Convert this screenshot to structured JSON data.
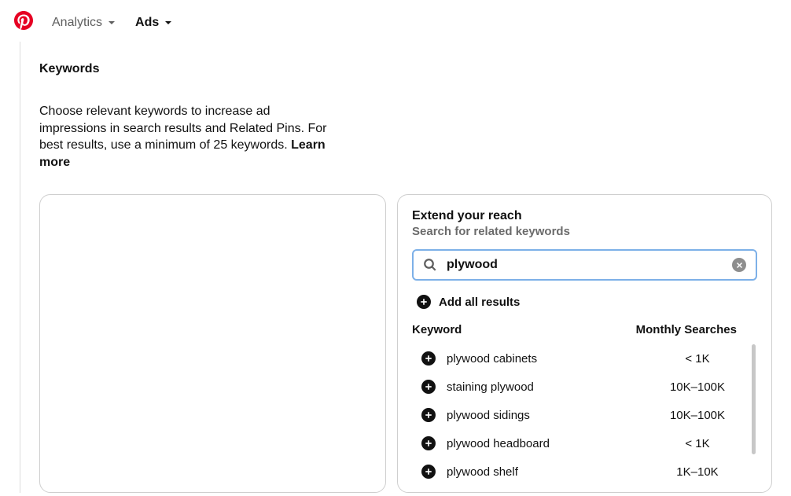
{
  "header": {
    "nav": {
      "analytics": "Analytics",
      "ads": "Ads"
    }
  },
  "section_title": "Keywords",
  "help_text": {
    "body": "Choose relevant keywords to increase ad impressions in search results and Related Pins. For best results, use a minimum of 25 keywords. ",
    "link": "Learn more"
  },
  "reach": {
    "title": "Extend your reach",
    "subtitle": "Search for related keywords",
    "search_value": "plywood",
    "add_all_label": "Add all results",
    "col_keyword": "Keyword",
    "col_searches": "Monthly Searches",
    "results": [
      {
        "keyword": "plywood cabinets",
        "searches": "< 1K"
      },
      {
        "keyword": "staining plywood",
        "searches": "10K–100K"
      },
      {
        "keyword": "plywood sidings",
        "searches": "10K–100K"
      },
      {
        "keyword": "plywood headboard",
        "searches": "< 1K"
      },
      {
        "keyword": "plywood shelf",
        "searches": "1K–10K"
      }
    ]
  }
}
